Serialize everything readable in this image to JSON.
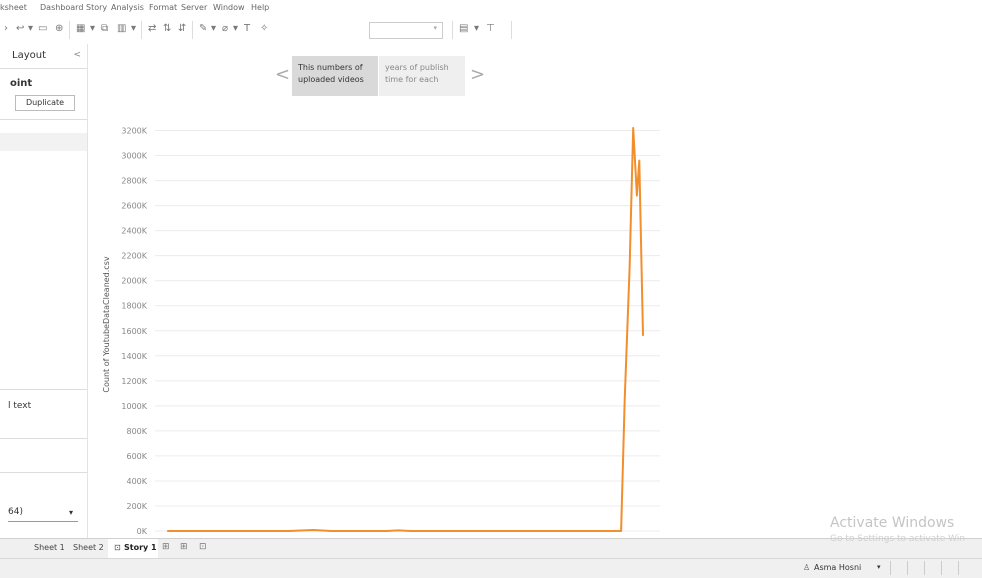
{
  "menu": [
    "ksheet",
    "Dashboard",
    "Story",
    "Analysis",
    "Format",
    "Server",
    "Window",
    "Help"
  ],
  "left_panel": {
    "tab_label": "Layout",
    "collapse_glyph": "<",
    "point_title": "oint",
    "duplicate_label": "Duplicate",
    "text_label": "l text",
    "select_value": "64)",
    "select_caret": "▾"
  },
  "story": {
    "prev_glyph": "<",
    "next_glyph": ">",
    "points": [
      {
        "line1": "This numbers of",
        "line2": "uploaded videos"
      },
      {
        "line1": "years of publish",
        "line2": "time for each"
      }
    ]
  },
  "chart_data": {
    "type": "line",
    "ylabel": "Count of YoutubeDataCleaned.csv",
    "y_ticks": [
      "0K",
      "200K",
      "400K",
      "600K",
      "800K",
      "1000K",
      "1200K",
      "1400K",
      "1600K",
      "1800K",
      "2000K",
      "2200K",
      "2400K",
      "2600K",
      "2800K",
      "3000K",
      "3200K"
    ],
    "ylim": [
      0,
      3300
    ],
    "unit": "K",
    "grid": true,
    "color": "#F28E2B",
    "series": [
      {
        "points": [
          [
            0,
            0
          ],
          [
            60,
            0
          ],
          [
            100,
            0
          ],
          [
            120,
            8
          ],
          [
            135,
            0
          ],
          [
            180,
            0
          ],
          [
            190,
            5
          ],
          [
            200,
            0
          ],
          [
            260,
            0
          ],
          [
            320,
            0
          ],
          [
            373,
            0
          ],
          [
            376,
            1050
          ],
          [
            380,
            2100
          ],
          [
            383,
            3220
          ],
          [
            386,
            2680
          ],
          [
            388,
            2960
          ],
          [
            391,
            1560
          ]
        ]
      }
    ],
    "xlim": [
      -10,
      405
    ]
  },
  "tabs": {
    "sheet1": "Sheet 1",
    "sheet2": "Sheet 2",
    "story1": "Story 1",
    "story_icon": "⊡"
  },
  "status": {
    "user": "Asma Hosni",
    "user_glyph": "♙",
    "caret": "▾"
  },
  "watermark": {
    "line1": "Activate Windows",
    "line2": "Go to Settings to activate Win"
  },
  "colors": {
    "line": "#F28E2B",
    "gridline": "#ececec",
    "tick_text": "#888888"
  }
}
